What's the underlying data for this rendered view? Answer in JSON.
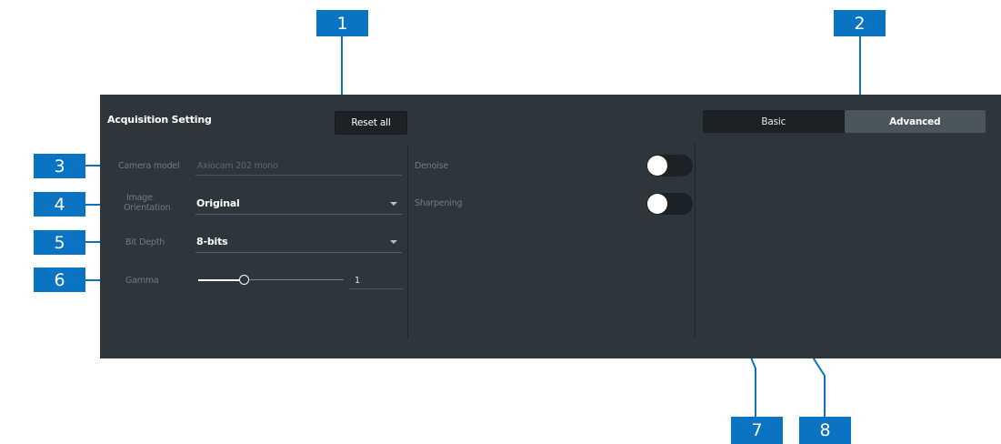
{
  "panel": {
    "title": "Acquisition Setting",
    "reset_button": "Reset all",
    "tabs": [
      {
        "label": "Basic",
        "active": false
      },
      {
        "label": "Advanced",
        "active": true
      }
    ]
  },
  "fields": {
    "camera_model": {
      "label": "Camera model",
      "value": "Axiocam 202 mono"
    },
    "image_orientation": {
      "label_line1": "Image",
      "label_line2": "Orientation",
      "value": "Original"
    },
    "bit_depth": {
      "label": "Bit Depth",
      "value": "8-bits"
    },
    "gamma": {
      "label": "Gamma",
      "value": "1",
      "slider_fraction": 0.31
    }
  },
  "processing": {
    "denoise": {
      "label": "Denoise",
      "on": false
    },
    "sharpening": {
      "label": "Sharpening",
      "on": false
    }
  },
  "callouts": [
    "1",
    "2",
    "3",
    "4",
    "5",
    "6",
    "7",
    "8"
  ],
  "colors": {
    "panel_bg": "#2e363c",
    "callout_bg": "#0a73c2",
    "button_bg": "#1b2125"
  }
}
